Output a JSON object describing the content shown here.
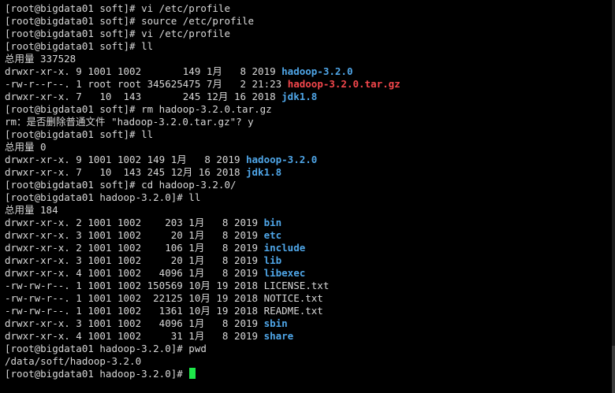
{
  "colors": {
    "background": "#000000",
    "text": "#d8d8d8",
    "directory": "#4fa6e8",
    "archive": "#f2464b",
    "cursor": "#1ee84a"
  },
  "terminal": {
    "lines": [
      {
        "text": "[root@bigdata01 soft]# vi /etc/profile"
      },
      {
        "text": "[root@bigdata01 soft]# source /etc/profile"
      },
      {
        "text": "[root@bigdata01 soft]# vi /etc/profile"
      },
      {
        "text": "[root@bigdata01 soft]# ll"
      },
      {
        "text": "总用量 337528"
      },
      {
        "text": "drwxr-xr-x. 9 1001 1002       149 1月   8 2019 ",
        "name": "hadoop-3.2.0",
        "kind": "dir"
      },
      {
        "text": "-rw-r--r--. 1 root root 345625475 7月   2 21:23 ",
        "name": "hadoop-3.2.0.tar.gz",
        "kind": "archive"
      },
      {
        "text": "drwxr-xr-x. 7   10  143       245 12月 16 2018 ",
        "name": "jdk1.8",
        "kind": "dir"
      },
      {
        "text": "[root@bigdata01 soft]# rm hadoop-3.2.0.tar.gz"
      },
      {
        "text": "rm：是否删除普通文件 \"hadoop-3.2.0.tar.gz\"? y"
      },
      {
        "text": "[root@bigdata01 soft]# ll"
      },
      {
        "text": "总用量 0"
      },
      {
        "text": "drwxr-xr-x. 9 1001 1002 149 1月   8 2019 ",
        "name": "hadoop-3.2.0",
        "kind": "dir"
      },
      {
        "text": "drwxr-xr-x. 7   10  143 245 12月 16 2018 ",
        "name": "jdk1.8",
        "kind": "dir"
      },
      {
        "text": "[root@bigdata01 soft]# cd hadoop-3.2.0/"
      },
      {
        "text": "[root@bigdata01 hadoop-3.2.0]# ll"
      },
      {
        "text": "总用量 184"
      },
      {
        "text": "drwxr-xr-x. 2 1001 1002    203 1月   8 2019 ",
        "name": "bin",
        "kind": "dir"
      },
      {
        "text": "drwxr-xr-x. 3 1001 1002     20 1月   8 2019 ",
        "name": "etc",
        "kind": "dir"
      },
      {
        "text": "drwxr-xr-x. 2 1001 1002    106 1月   8 2019 ",
        "name": "include",
        "kind": "dir"
      },
      {
        "text": "drwxr-xr-x. 3 1001 1002     20 1月   8 2019 ",
        "name": "lib",
        "kind": "dir"
      },
      {
        "text": "drwxr-xr-x. 4 1001 1002   4096 1月   8 2019 ",
        "name": "libexec",
        "kind": "dir"
      },
      {
        "text": "-rw-rw-r--. 1 1001 1002 150569 10月 19 2018 LICENSE.txt"
      },
      {
        "text": "-rw-rw-r--. 1 1001 1002  22125 10月 19 2018 NOTICE.txt"
      },
      {
        "text": "-rw-rw-r--. 1 1001 1002   1361 10月 19 2018 README.txt"
      },
      {
        "text": "drwxr-xr-x. 3 1001 1002   4096 1月   8 2019 ",
        "name": "sbin",
        "kind": "dir"
      },
      {
        "text": "drwxr-xr-x. 4 1001 1002     31 1月   8 2019 ",
        "name": "share",
        "kind": "dir"
      },
      {
        "text": "[root@bigdata01 hadoop-3.2.0]# pwd"
      },
      {
        "text": "/data/soft/hadoop-3.2.0"
      },
      {
        "text": "[root@bigdata01 hadoop-3.2.0]# "
      }
    ]
  },
  "cursor": {
    "icon": "block-cursor-icon"
  }
}
